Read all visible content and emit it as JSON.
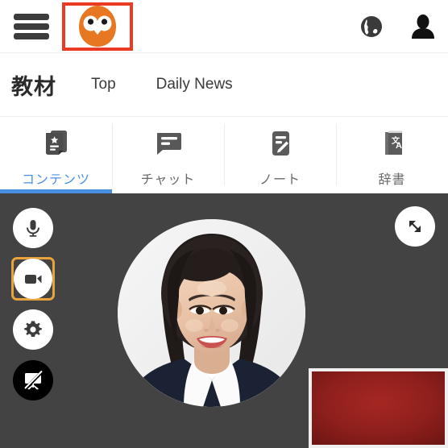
{
  "header": {
    "menu_button": "menu-hamburger",
    "logo": {
      "name": "owl-logo",
      "alt": "Owl brand logo",
      "highlight_color": "#ea3a23",
      "body_color": "#e87722"
    },
    "globe_label": "Language",
    "account_label": "Account"
  },
  "nav": {
    "title": "教材",
    "links": [
      {
        "label": "Top"
      },
      {
        "label": "Daily News"
      }
    ]
  },
  "tabs": {
    "active_color": "#4a90e2",
    "items": [
      {
        "label": "コンテンツ",
        "icon": "contents-book-star-icon",
        "active": true
      },
      {
        "label": "チャット",
        "icon": "chat-bubble-icon",
        "active": false
      },
      {
        "label": "ノート",
        "icon": "note-pencil-icon",
        "active": false
      },
      {
        "label": "辞書",
        "icon": "dictionary-translate-icon",
        "active": false
      }
    ]
  },
  "stage": {
    "background_color": "#434343",
    "controls": [
      {
        "name": "microphone-button",
        "icon": "microphone-icon",
        "style": "light",
        "selected": false
      },
      {
        "name": "camera-button",
        "icon": "video-camera-icon",
        "style": "light",
        "selected": true
      },
      {
        "name": "settings-button",
        "icon": "gear-icon",
        "style": "light",
        "selected": false
      },
      {
        "name": "whiteboard-off-button",
        "icon": "whiteboard-off-icon",
        "style": "dark",
        "selected": false
      }
    ],
    "selected_highlight_color": "#e8a33d",
    "expand_button": {
      "name": "expand-button",
      "icon": "expand-arrows-icon"
    },
    "avatar": {
      "name": "participant-avatar",
      "alt": "Tutor profile photo"
    },
    "self_view": {
      "name": "self-view-thumbnail",
      "border_color": "#efefef",
      "fill_color": "#8e1f1c"
    }
  }
}
